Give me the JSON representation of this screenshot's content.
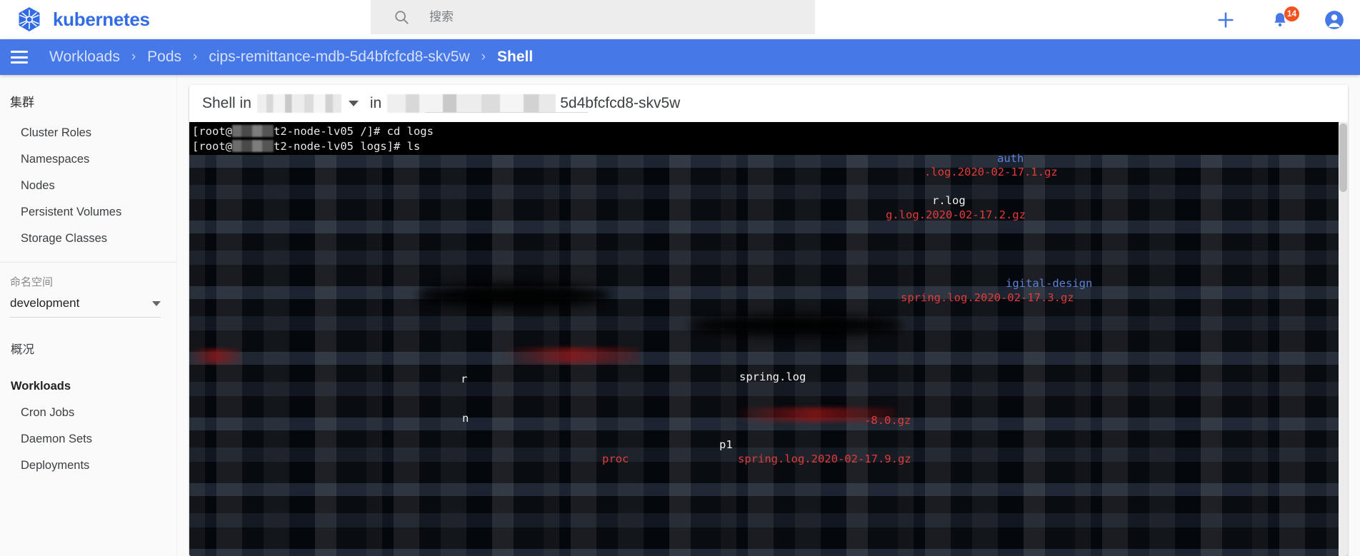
{
  "topbar": {
    "brand": "kubernetes",
    "logo_icon": "kubernetes-helm-wheel-logo",
    "search_icon": "search-icon",
    "search_placeholder": "搜索",
    "search_value": "",
    "add_icon": "plus-icon",
    "notifications_icon": "bell-icon",
    "notifications_count": "14",
    "account_icon": "user-account-icon",
    "badge_color": "#f4511e",
    "brand_color": "#326ce5"
  },
  "breadcrumb": {
    "menu_icon": "hamburger-menu-icon",
    "separator": "›",
    "items": [
      {
        "label": "Workloads",
        "current": false
      },
      {
        "label": "Pods",
        "current": false
      },
      {
        "label": "cips-remittance-mdb-5d4bfcfcd8-skv5w",
        "current": false
      },
      {
        "label": "Shell",
        "current": true
      }
    ],
    "bar_color": "#4678e8"
  },
  "sidebar": {
    "cluster_section": {
      "title": "集群",
      "items": [
        {
          "label": "Cluster Roles"
        },
        {
          "label": "Namespaces"
        },
        {
          "label": "Nodes"
        },
        {
          "label": "Persistent Volumes"
        },
        {
          "label": "Storage Classes"
        }
      ]
    },
    "namespace_section": {
      "title": "命名空间",
      "selected": "development",
      "caret_icon": "chevron-down-icon"
    },
    "overview_label": "概况",
    "workloads_section": {
      "title": "Workloads",
      "items": [
        {
          "label": "Cron Jobs"
        },
        {
          "label": "Daemon Sets"
        },
        {
          "label": "Deployments"
        }
      ]
    }
  },
  "shell": {
    "prefix_label": "Shell in",
    "container_name_redacted": true,
    "dropdown_icon": "chevron-down-icon",
    "middle_label": "in",
    "pod_name_visible_tail": "5d4bfcfcd8-skv5w",
    "terminal": {
      "lines": [
        {
          "prompt_prefix": "[root@",
          "host_redacted": true,
          "host_tail": "t2-node-lv05 /]# ",
          "command": "cd logs"
        },
        {
          "prompt_prefix": "[root@",
          "host_redacted": true,
          "host_tail": "t2-node-lv05 logs]# ",
          "command": "ls"
        }
      ],
      "visible_entries": [
        {
          "text": "auth",
          "color": "blue"
        },
        {
          "text": ".log.2020-02-17.1.gz",
          "color": "red"
        },
        {
          "text": "r.log",
          "color": "white"
        },
        {
          "text": "g.log.2020-02-17.2.gz",
          "color": "red"
        },
        {
          "text": "igital-design",
          "color": "blue"
        },
        {
          "text": "spring.log.2020-02-17.3.gz",
          "color": "red"
        },
        {
          "text": "spring.log",
          "color": "white"
        },
        {
          "text": "-8.0.gz",
          "color": "red"
        },
        {
          "text": "proc",
          "color": "red"
        },
        {
          "text": "spring.log.2020-02-17.9.gz",
          "color": "red"
        },
        {
          "text": "p1",
          "color": "white"
        },
        {
          "text": "r",
          "color": "white"
        },
        {
          "text": "n",
          "color": "white"
        }
      ],
      "background": "#000000",
      "red_color": "#e33a3a",
      "blue_color": "#5b82d8"
    },
    "scrollbar_icon": "vertical-scrollbar"
  }
}
